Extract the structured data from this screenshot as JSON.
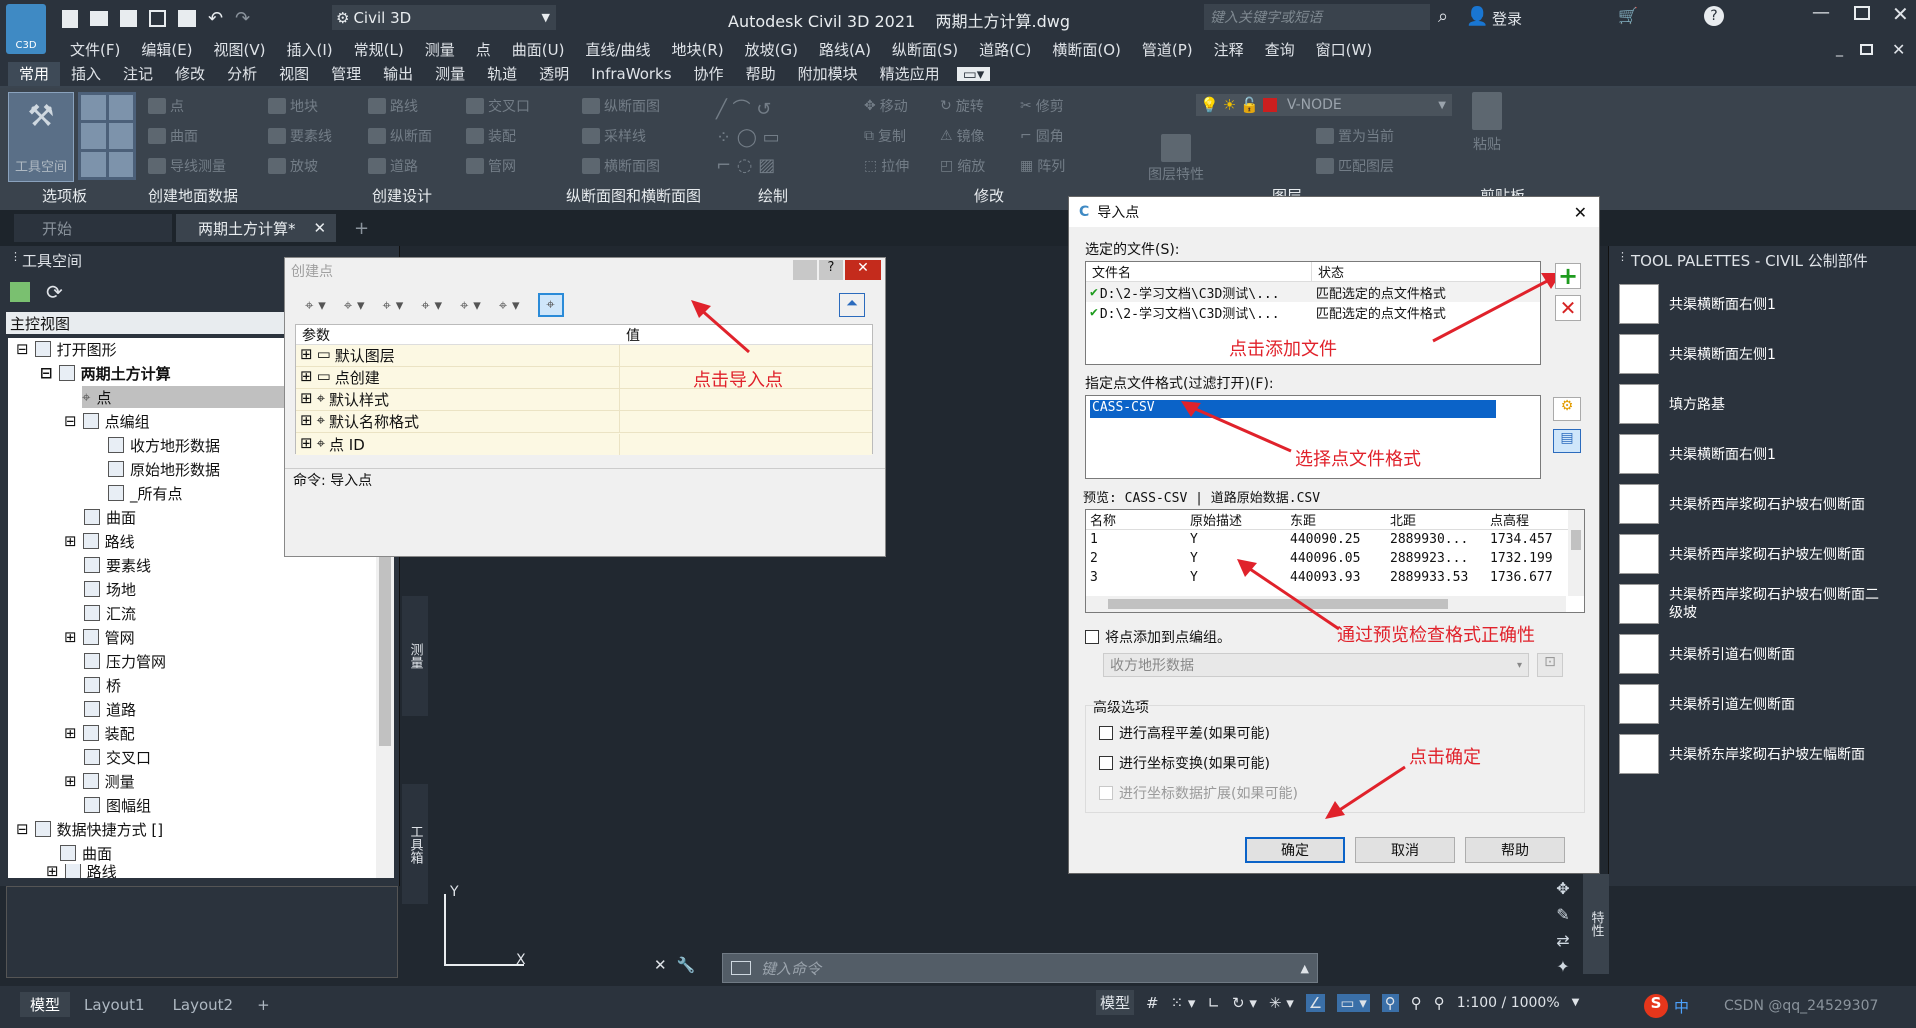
{
  "app": {
    "logo": "C3D",
    "workspace": "Civil 3D",
    "title": "Autodesk Civil 3D 2021    两期土方计算.dwg",
    "search_placeholder": "键入关键字或短语",
    "login": "登录"
  },
  "menu": [
    "文件(F)",
    "编辑(E)",
    "视图(V)",
    "插入(I)",
    "常规(L)",
    "测量",
    "点",
    "曲面(U)",
    "直线/曲线",
    "地块(R)",
    "放坡(G)",
    "路线(A)",
    "纵断面(S)",
    "道路(C)",
    "横断面(O)",
    "管道(P)",
    "注释",
    "查询",
    "窗口(W)"
  ],
  "ribbon_tabs": [
    "常用",
    "插入",
    "注记",
    "修改",
    "分析",
    "视图",
    "管理",
    "输出",
    "测量",
    "轨道",
    "透明",
    "InfraWorks",
    "协作",
    "帮助",
    "附加模块",
    "精选应用"
  ],
  "ribbon": {
    "toolspace": "工具空间",
    "panels": [
      "选项板",
      "创建地面数据",
      "创建设计",
      "纵断面图和横断面图",
      "绘制",
      "修改",
      "图层",
      "剪贴板"
    ],
    "items": [
      "点",
      "曲面",
      "导线测量",
      "地块",
      "要素线",
      "放坡",
      "路线",
      "纵断面",
      "道路",
      "交叉口",
      "装配",
      "管网",
      "纵断面图",
      "采样线",
      "横断面图",
      "移动",
      "旋转",
      "修剪",
      "复制",
      "镜像",
      "圆角",
      "拉伸",
      "缩放",
      "阵列",
      "图层特性",
      "置为当前",
      "匹配图层",
      "粘贴"
    ],
    "layer": "V-NODE"
  },
  "doc_tabs": {
    "start": "开始",
    "active": "两期土方计算*",
    "plus": "+"
  },
  "left_panel": {
    "title": "工具空间",
    "view": "主控视图",
    "tree": [
      "打开图形",
      "两期土方计算",
      "点",
      "点编组",
      "收方地形数据",
      "原始地形数据",
      "_所有点",
      "曲面",
      "路线",
      "要素线",
      "场地",
      "汇流",
      "管网",
      "压力管网",
      "桥",
      "道路",
      "装配",
      "交叉口",
      "测量",
      "图幅组",
      "数据快捷方式 []",
      "曲面",
      "路线"
    ]
  },
  "create_point": {
    "title": "创建点",
    "col_param": "参数",
    "col_value": "值",
    "rows": [
      "默认图层",
      "点创建",
      "默认样式",
      "默认名称格式",
      "点 ID"
    ],
    "note": "点击导入点",
    "command": "命令: 导入点"
  },
  "import": {
    "title": "导入点",
    "files_label": "选定的文件(S):",
    "col_file": "文件名",
    "col_status": "状态",
    "files": [
      {
        "name": "D:\\2-学习文档\\C3D测试\\...",
        "status": "匹配选定的点文件格式"
      },
      {
        "name": "D:\\2-学习文档\\C3D测试\\...",
        "status": "匹配选定的点文件格式"
      }
    ],
    "note_add": "点击添加文件",
    "format_label": "指定点文件格式(过滤打开)(F):",
    "format_selected": "CASS-CSV",
    "note_format": "选择点文件格式",
    "preview_label": "预览: CASS-CSV | 道路原始数据.CSV",
    "preview_cols": [
      "名称",
      "原始描述",
      "东距",
      "北距",
      "点高程"
    ],
    "preview_rows": [
      [
        "1",
        "Y",
        "440090.25",
        "2889930...",
        "1734.457"
      ],
      [
        "2",
        "Y",
        "440096.05",
        "2889923...",
        "1732.199"
      ],
      [
        "3",
        "Y",
        "440093.93",
        "2889933.53",
        "1736.677"
      ]
    ],
    "note_preview": "通过预览检查格式正确性",
    "add_group": "将点添加到点编组。",
    "group_value": "收方地形数据",
    "adv_label": "高级选项",
    "opt1": "进行高程平差(如果可能)",
    "opt2": "进行坐标变换(如果可能)",
    "opt3": "进行坐标数据扩展(如果可能)",
    "note_ok": "点击确定",
    "ok": "确定",
    "cancel": "取消",
    "help": "帮助"
  },
  "tool_palettes": {
    "title": "TOOL PALETTES - CIVIL 公制部件",
    "items": [
      "共渠横断面右侧1",
      "共渠横断面左侧1",
      "填方路基",
      "共渠横断面右侧1",
      "共渠桥西岸浆砌石护坡右侧断面",
      "共渠桥西岸浆砌石护坡左侧断面",
      "共渠桥西岸浆砌石护坡右侧断面二级坡",
      "共渠桥引道右侧断面",
      "共渠桥引道左侧断面",
      "共渠桥东岸浆砌石护坡左幅断面"
    ],
    "side_label": "特性"
  },
  "side_tabs": {
    "survey": "测量",
    "toolbox": "工具箱"
  },
  "command_placeholder": "键入命令",
  "status": {
    "model": "模型",
    "layout1": "Layout1",
    "layout2": "Layout2",
    "scale": "1:100 / 1000%",
    "ime": "中",
    "watermark": "CSDN @qq_24529307"
  }
}
